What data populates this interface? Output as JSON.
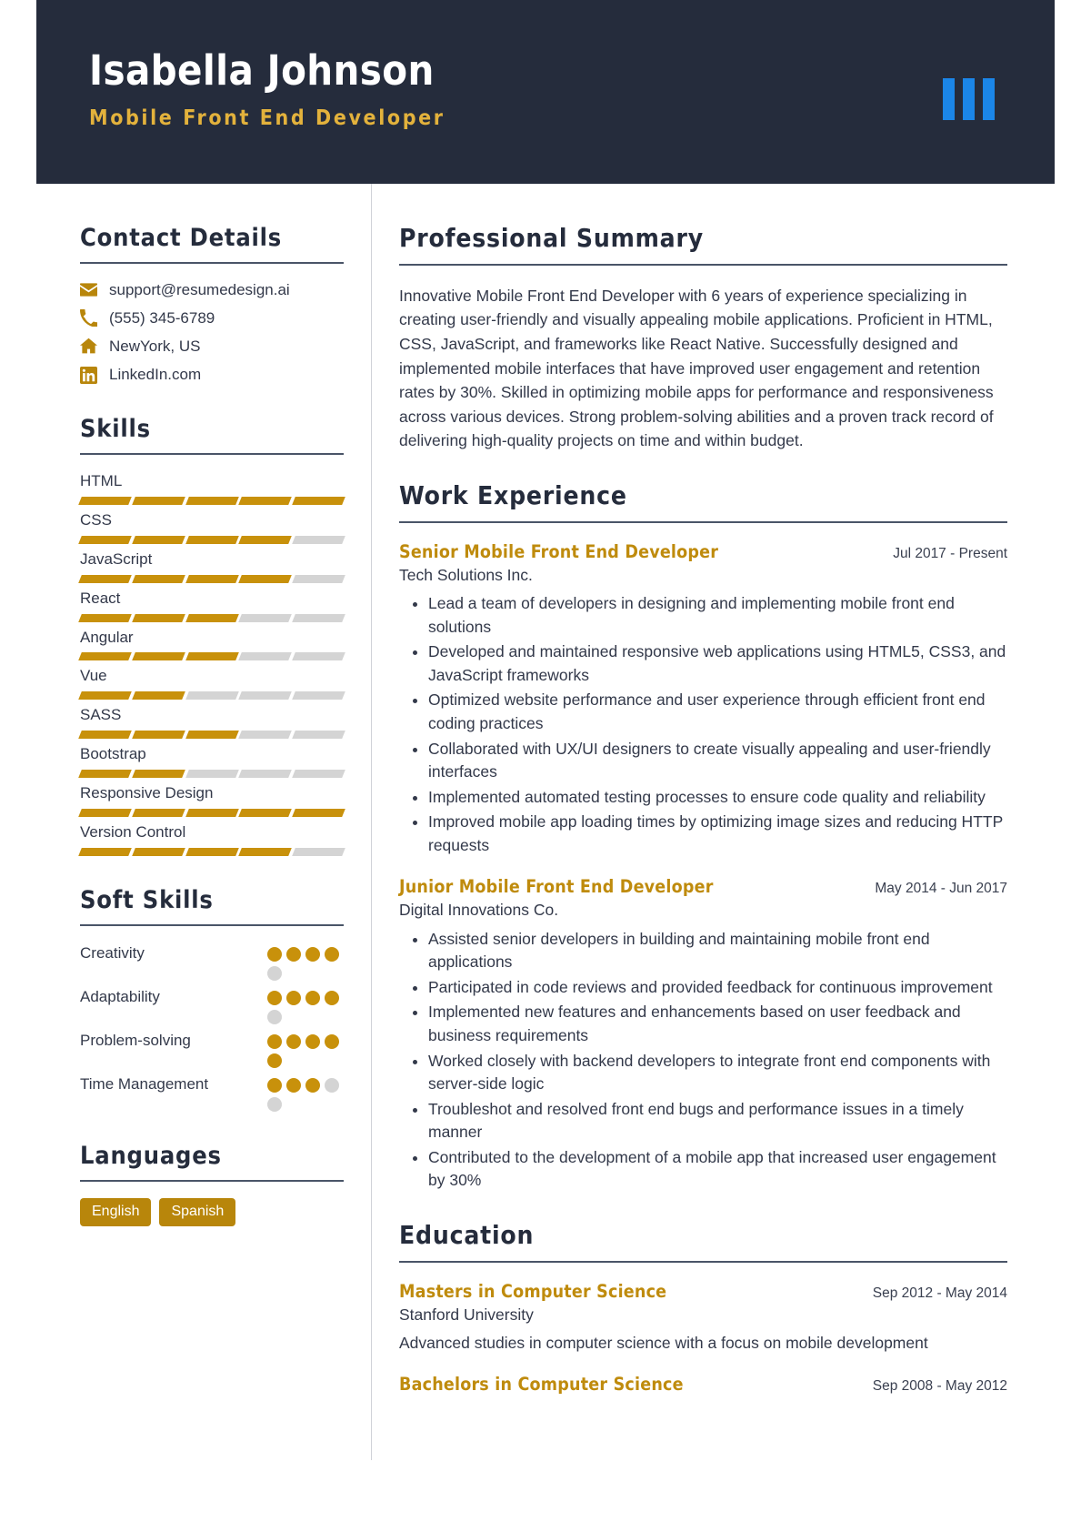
{
  "header": {
    "name": "Isabella Johnson",
    "title": "Mobile Front End Developer",
    "logo_color": "#1b86e8",
    "bg_color": "#252c3c",
    "title_color": "#e3b23c"
  },
  "accent_color": "#b8860b",
  "sidebar": {
    "contact": {
      "heading": "Contact Details",
      "items": [
        {
          "icon": "envelope-icon",
          "value": "support@resumedesign.ai"
        },
        {
          "icon": "phone-icon",
          "value": "(555) 345-6789"
        },
        {
          "icon": "home-icon",
          "value": "NewYork, US"
        },
        {
          "icon": "linkedin-icon",
          "value": "LinkedIn.com"
        }
      ]
    },
    "skills": {
      "heading": "Skills",
      "max": 5,
      "items": [
        {
          "name": "HTML",
          "level": 5
        },
        {
          "name": "CSS",
          "level": 4
        },
        {
          "name": "JavaScript",
          "level": 4
        },
        {
          "name": "React",
          "level": 3
        },
        {
          "name": "Angular",
          "level": 3
        },
        {
          "name": "Vue",
          "level": 2
        },
        {
          "name": "SASS",
          "level": 3
        },
        {
          "name": "Bootstrap",
          "level": 2
        },
        {
          "name": "Responsive Design",
          "level": 5
        },
        {
          "name": "Version Control",
          "level": 4
        }
      ]
    },
    "soft_skills": {
      "heading": "Soft Skills",
      "max": 5,
      "items": [
        {
          "name": "Creativity",
          "level": 4
        },
        {
          "name": "Adaptability",
          "level": 4
        },
        {
          "name": "Problem-solving",
          "level": 5
        },
        {
          "name": "Time Management",
          "level": 3
        }
      ]
    },
    "languages": {
      "heading": "Languages",
      "items": [
        "English",
        "Spanish"
      ]
    }
  },
  "main": {
    "summary": {
      "heading": "Professional Summary",
      "text": "Innovative Mobile Front End Developer with 6 years of experience specializing in creating user-friendly and visually appealing mobile applications. Proficient in HTML, CSS, JavaScript, and frameworks like React Native. Successfully designed and implemented mobile interfaces that have improved user engagement and retention rates by 30%. Skilled in optimizing mobile apps for performance and responsiveness across various devices. Strong problem-solving abilities and a proven track record of delivering high-quality projects on time and within budget."
    },
    "work": {
      "heading": "Work Experience",
      "entries": [
        {
          "role": "Senior Mobile Front End Developer",
          "date": "Jul 2017 - Present",
          "org": "Tech Solutions Inc.",
          "bullets": [
            "Lead a team of developers in designing and implementing mobile front end solutions",
            "Developed and maintained responsive web applications using HTML5, CSS3, and JavaScript frameworks",
            "Optimized website performance and user experience through efficient front end coding practices",
            "Collaborated with UX/UI designers to create visually appealing and user-friendly interfaces",
            "Implemented automated testing processes to ensure code quality and reliability",
            "Improved mobile app loading times by optimizing image sizes and reducing HTTP requests"
          ]
        },
        {
          "role": "Junior Mobile Front End Developer",
          "date": "May 2014 - Jun 2017",
          "org": "Digital Innovations Co.",
          "bullets": [
            "Assisted senior developers in building and maintaining mobile front end applications",
            "Participated in code reviews and provided feedback for continuous improvement",
            "Implemented new features and enhancements based on user feedback and business requirements",
            "Worked closely with backend developers to integrate front end components with server-side logic",
            "Troubleshot and resolved front end bugs and performance issues in a timely manner",
            "Contributed to the development of a mobile app that increased user engagement by 30%"
          ]
        }
      ]
    },
    "education": {
      "heading": "Education",
      "entries": [
        {
          "degree": "Masters in Computer Science",
          "date": "Sep 2012 - May 2014",
          "school": "Stanford University",
          "desc": "Advanced studies in computer science with a focus on mobile development"
        },
        {
          "degree": "Bachelors in Computer Science",
          "date": "Sep 2008 - May 2012",
          "school": "",
          "desc": ""
        }
      ]
    }
  }
}
